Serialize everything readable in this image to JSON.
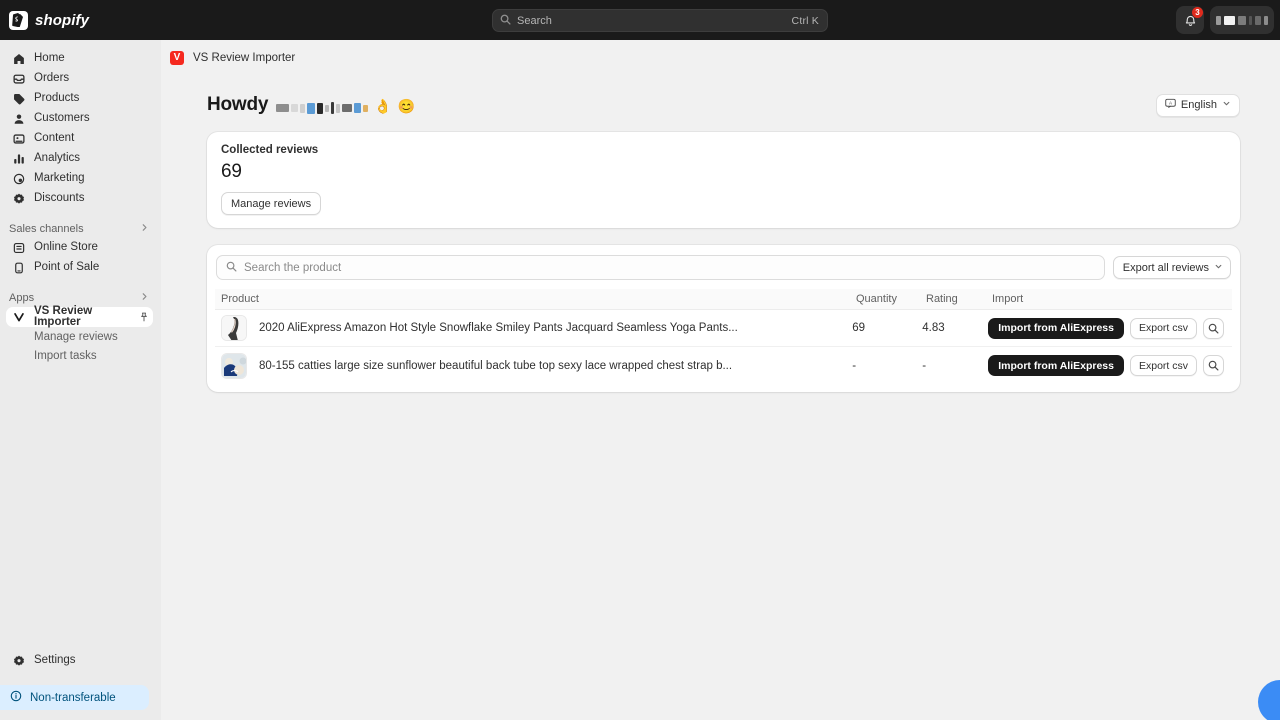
{
  "topbar": {
    "brand": "shopify",
    "brand_icon": "shopify-bag-icon",
    "search": {
      "placeholder": "Search",
      "shortcut": "Ctrl K",
      "icon": "search-icon"
    },
    "notifications": {
      "icon": "bell-icon",
      "count": "3"
    },
    "user_chip": {
      "label": "",
      "redacted": true
    }
  },
  "sidebar": {
    "items": [
      {
        "label": "Home",
        "icon": "home-icon"
      },
      {
        "label": "Orders",
        "icon": "orders-icon"
      },
      {
        "label": "Products",
        "icon": "products-tag-icon"
      },
      {
        "label": "Customers",
        "icon": "customers-person-icon"
      },
      {
        "label": "Content",
        "icon": "content-icon"
      },
      {
        "label": "Analytics",
        "icon": "analytics-bars-icon"
      },
      {
        "label": "Marketing",
        "icon": "marketing-megaphone-icon"
      },
      {
        "label": "Discounts",
        "icon": "discounts-gear-icon"
      }
    ],
    "sections": [
      {
        "title": "Sales channels",
        "chevron": "chevron-right-icon",
        "items": [
          {
            "label": "Online Store",
            "icon": "online-store-icon"
          },
          {
            "label": "Point of Sale",
            "icon": "point-of-sale-icon"
          }
        ]
      },
      {
        "title": "Apps",
        "chevron": "chevron-right-icon",
        "items": [
          {
            "label": "VS Review Importer",
            "icon": "vs-check-icon",
            "active": true,
            "pin": "pin-icon"
          }
        ],
        "subitems": [
          {
            "label": "Manage reviews"
          },
          {
            "label": "Import tasks"
          }
        ]
      }
    ],
    "settings": {
      "label": "Settings",
      "icon": "gear-icon"
    },
    "notice": {
      "label": "Non-transferable",
      "icon": "info-circle-icon",
      "color": "#dbeeff"
    }
  },
  "app": {
    "breadcrumb": "VS Review Importer",
    "icon_letter": "V",
    "icon_color": "#f5291f",
    "greeting": "Howdy",
    "greeting_emoji_1": "👌",
    "greeting_emoji_2": "😊",
    "language": {
      "label": "English",
      "icon": "language-icon",
      "chevron": "chevron-down-icon"
    }
  },
  "stat_card": {
    "label": "Collected reviews",
    "value": "69",
    "button": "Manage reviews"
  },
  "table": {
    "search_placeholder": "Search the product",
    "search_icon": "search-icon",
    "export_all_button": "Export all reviews",
    "export_all_chevron": "chevron-down-icon",
    "columns": [
      "Product",
      "Quantity",
      "Rating",
      "Import"
    ],
    "rows": [
      {
        "product": "2020 AliExpress Amazon Hot Style Snowflake Smiley Pants Jacquard Seamless Yoga Pants...",
        "thumb": "yoga-pants-thumbnail",
        "quantity": "69",
        "rating": "4.83",
        "import_button": "Import from AliExpress",
        "export_button": "Export csv",
        "preview_icon": "search-icon"
      },
      {
        "product": "80-155 catties large size sunflower beautiful back tube top sexy lace wrapped chest strap b...",
        "thumb": "chest-strap-thumbnail",
        "quantity": "-",
        "rating": "-",
        "import_button": "Import from AliExpress",
        "export_button": "Export csv",
        "preview_icon": "search-icon"
      }
    ]
  },
  "chat_widget": {
    "icon": "chat-bubble-icon",
    "color": "#3b8cf5"
  }
}
